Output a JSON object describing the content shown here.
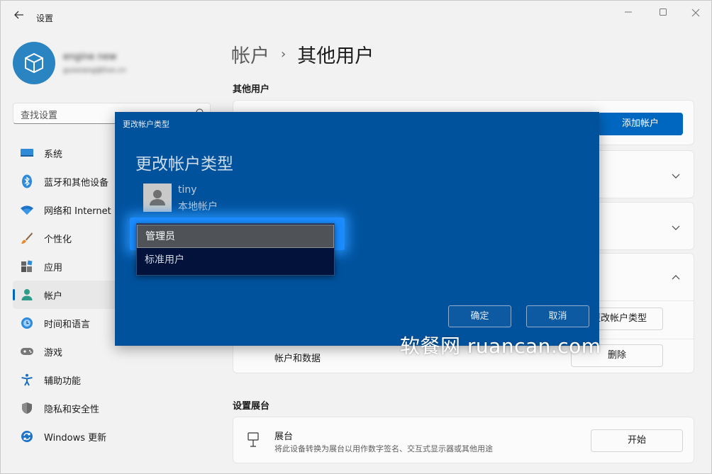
{
  "window": {
    "title": "设置",
    "back_icon": "arrow-left-icon",
    "controls": [
      "minimize-icon",
      "maximize-icon",
      "close-icon"
    ]
  },
  "profile": {
    "name": "engine new",
    "email": "guoxiang@live.cn"
  },
  "search": {
    "placeholder": "查找设置",
    "icon": "search-icon"
  },
  "sidebar": {
    "items": [
      {
        "label": "系统",
        "icon": "monitor-icon",
        "active": false
      },
      {
        "label": "蓝牙和其他设备",
        "icon": "bluetooth-icon",
        "active": false
      },
      {
        "label": "网络和 Internet",
        "icon": "wifi-icon",
        "active": false
      },
      {
        "label": "个性化",
        "icon": "brush-icon",
        "active": false
      },
      {
        "label": "应用",
        "icon": "apps-icon",
        "active": false
      },
      {
        "label": "帐户",
        "icon": "person-icon",
        "active": true
      },
      {
        "label": "时间和语言",
        "icon": "globe-clock-icon",
        "active": false
      },
      {
        "label": "游戏",
        "icon": "gamepad-icon",
        "active": false
      },
      {
        "label": "辅助功能",
        "icon": "accessibility-icon",
        "active": false
      },
      {
        "label": "隐私和安全性",
        "icon": "shield-icon",
        "active": false
      },
      {
        "label": "Windows 更新",
        "icon": "update-icon",
        "active": false
      }
    ]
  },
  "main": {
    "breadcrumb_parent": "帐户",
    "breadcrumb_separator": "›",
    "breadcrumb_current": "其他用户",
    "other_users_heading": "其他用户",
    "add_account_button": "添加帐户",
    "change_type_button": "更改帐户类型",
    "account_data_label": "帐户和数据",
    "delete_button": "删除",
    "kiosk_heading": "设置展台",
    "kiosk_title": "展台",
    "kiosk_desc": "将此设备转换为展台以用作数字签名、交互式显示器或其他用途",
    "kiosk_button": "开始"
  },
  "dialog": {
    "caption": "更改帐户类型",
    "heading": "更改帐户类型",
    "user_name": "tiny",
    "user_type": "本地帐户",
    "options": [
      "管理员",
      "标准用户"
    ],
    "selected_option": "管理员",
    "ok_button": "确定",
    "cancel_button": "取消"
  },
  "watermark": "软餐网 ruancan.com",
  "colors": {
    "accent": "#0067c0",
    "dialog_bg": "#00529d",
    "dropdown_bg": "#02123a"
  }
}
